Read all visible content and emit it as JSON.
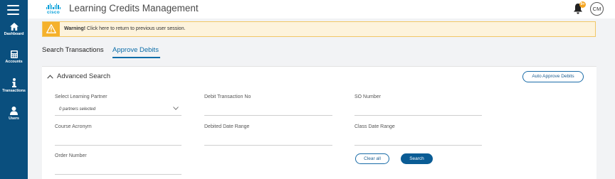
{
  "sidebar": {
    "items": [
      {
        "label": "Dashboard",
        "icon": "home-icon"
      },
      {
        "label": "Accounts",
        "icon": "calculator-icon"
      },
      {
        "label": "Transactions",
        "icon": "info-icon"
      },
      {
        "label": "Users",
        "icon": "user-icon"
      }
    ]
  },
  "header": {
    "logo_text": "cisco",
    "title": "Learning Credits Management",
    "notification_count": "9+",
    "avatar_initials": "CM"
  },
  "warning": {
    "label": "Warning!",
    "message": "Click here to return to previous user session."
  },
  "tabs": [
    {
      "label": "Search Transactions",
      "active": false
    },
    {
      "label": "Approve Debits",
      "active": true
    }
  ],
  "search_panel": {
    "title": "Advanced Search",
    "auto_approve_label": "Auto Approve Debits",
    "fields": {
      "learning_partner_label": "Select Learning Partner",
      "learning_partner_value": "0 partners selected",
      "debit_transaction_label": "Debit Transaction No",
      "so_number_label": "SO Number",
      "course_acronym_label": "Course Acronym",
      "debited_date_label": "Debited Date Range",
      "class_date_label": "Class Date Range",
      "order_number_label": "Order Number"
    },
    "clear_label": "Clear all",
    "search_label": "Search"
  },
  "colors": {
    "sidebar": "#0a4f7e",
    "accent": "#0a6ca8",
    "warning_bg": "#fdf3dc",
    "warning_icon_bg": "#f5b12c",
    "badge": "#f5a623"
  }
}
